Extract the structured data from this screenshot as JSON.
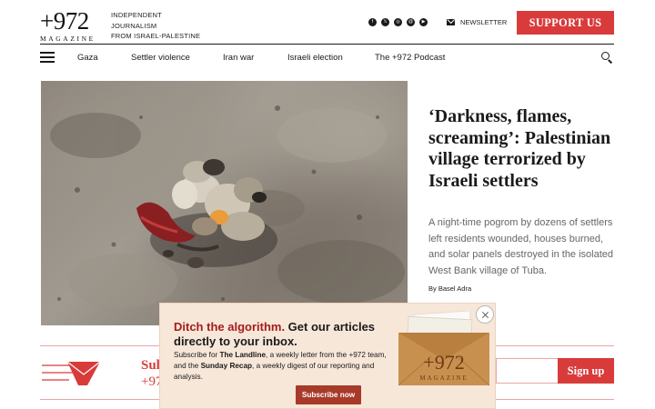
{
  "header": {
    "logo_main": "+972",
    "logo_sub": "MAGAZINE",
    "tagline": [
      "INDEPENDENT",
      "JOURNALISM",
      "FROM ISRAEL-PALESTINE"
    ],
    "social_icons": [
      "facebook-icon",
      "x-icon",
      "instagram-icon",
      "threads-icon",
      "youtube-icon"
    ],
    "newsletter_label": "NEWSLETTER",
    "support_label": "SUPPORT US"
  },
  "nav": {
    "items": [
      "Gaza",
      "Settler violence",
      "Iran war",
      "Israeli election",
      "The +972 Podcast"
    ]
  },
  "hero": {
    "title": "‘Darkness, flames, screaming’: Palestinian village terrorized by Israeli settlers",
    "summary": "A night-time pogrom by dozens of settlers left residents wounded, houses burned, and solar panels destroyed in the isolated West Bank village of Tuba.",
    "byline": "By Basel Adra"
  },
  "band": {
    "title": "Sul",
    "sub": "+97",
    "button_label": "Sign up"
  },
  "popup": {
    "headline_red": "Ditch the algorithm.",
    "headline_rest": " Get our articles directly to your inbox.",
    "body_1": "Subscribe for ",
    "landline": "The Landline",
    "body_2": ", a weekly letter from the +972 team, and the ",
    "sunday": "Sunday Recap",
    "body_3": ", a weekly digest of our reporting and analysis.",
    "button_label": "Subscribe now",
    "envelope_logo": "+972",
    "envelope_sub": "MAGAZINE"
  },
  "colors": {
    "brand_red": "#d93b3b",
    "popup_bg": "#f7e7d9",
    "popup_button": "#a83a2a",
    "envelope": "#c28a4a"
  }
}
